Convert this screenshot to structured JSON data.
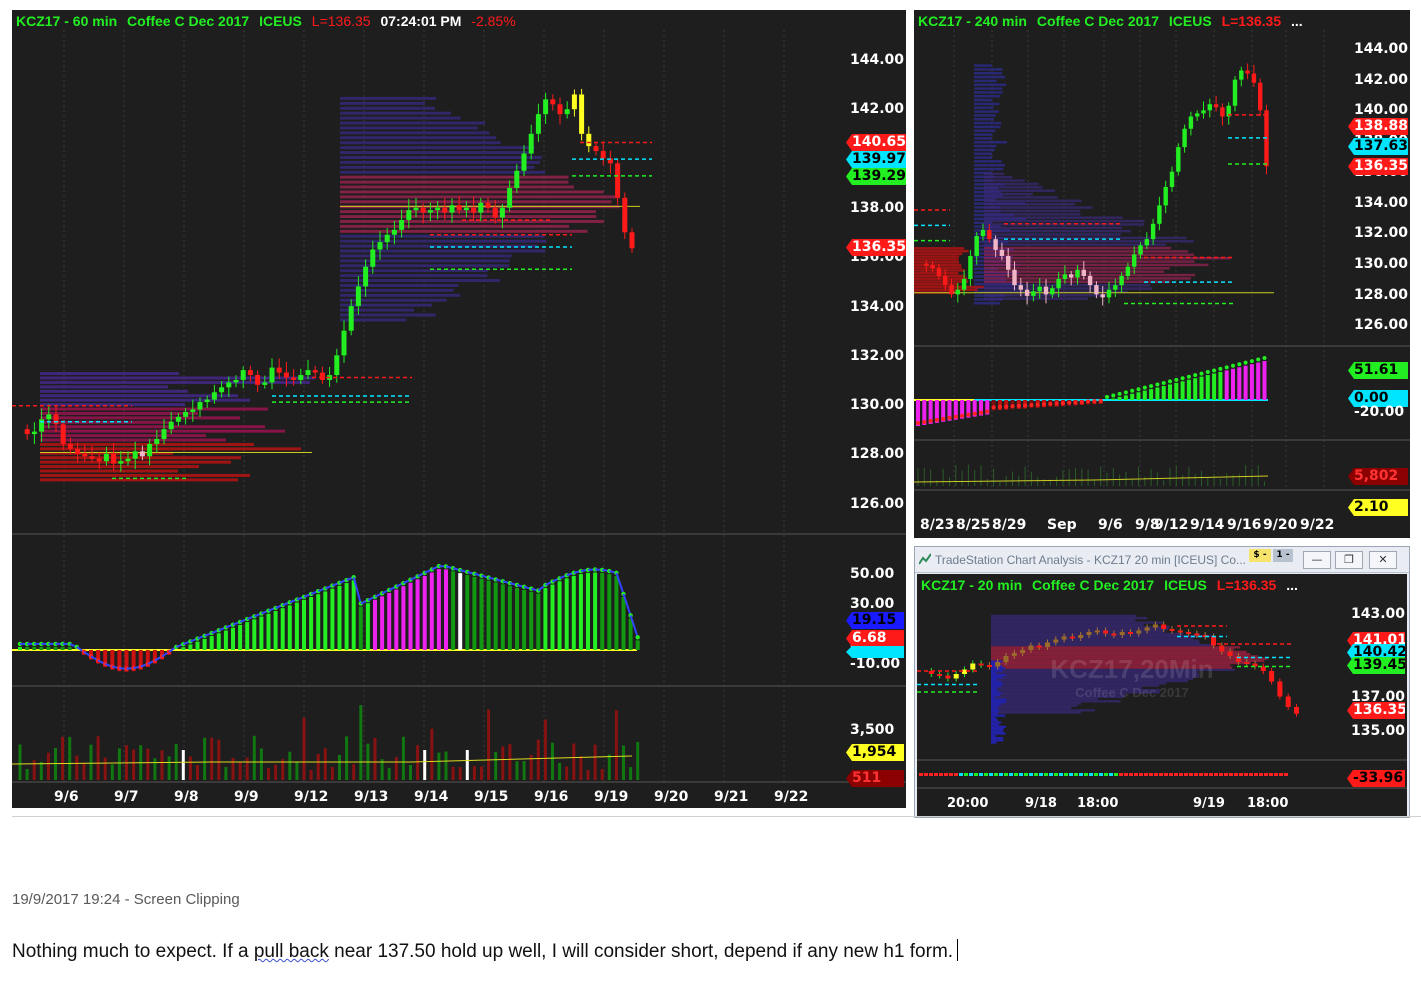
{
  "left_chart": {
    "symbol": "KCZ17 - 60 min",
    "name": "Coffee C Dec 2017",
    "exchange": "ICEUS",
    "last": "L=136.35",
    "time": "07:24:01 PM",
    "change": "-2.85%",
    "price_axis": [
      "144.00",
      "142.00",
      "140.00",
      "138.00",
      "136.00",
      "134.00",
      "132.00",
      "130.00",
      "128.00",
      "126.00"
    ],
    "price_flags": [
      {
        "label": "140.65",
        "color": "#ff1a1a",
        "text": "#ffffff"
      },
      {
        "label": "139.97",
        "color": "#00e5ff",
        "text": "#000000"
      },
      {
        "label": "139.29",
        "color": "#22ee22",
        "text": "#000000"
      },
      {
        "label": "136.35",
        "color": "#ff1a1a",
        "text": "#ffffff"
      }
    ],
    "osc_axis": [
      "50.00",
      "30.00",
      "0.00",
      "-10.00"
    ],
    "osc_flags": [
      {
        "label": "19.15",
        "color": "#1a1aff",
        "text": "#000000"
      },
      {
        "label": "6.68",
        "color": "#ff1a1a",
        "text": "#ffffff"
      },
      {
        "label": "",
        "color": "#00e5ff",
        "text": "#000000"
      }
    ],
    "vol_axis": [
      "3,500"
    ],
    "vol_flags": [
      {
        "label": "1,954",
        "color": "#ffff22",
        "text": "#000000"
      },
      {
        "label": "511",
        "color": "#8b0000",
        "text": "#ff3333"
      }
    ],
    "dates": [
      "9/6",
      "9/7",
      "9/8",
      "9/9",
      "9/12",
      "9/13",
      "9/14",
      "9/15",
      "9/16",
      "9/19",
      "9/20",
      "9/21",
      "9/22"
    ]
  },
  "right_top_chart": {
    "symbol": "KCZ17 - 240 min",
    "name": "Coffee C Dec 2017",
    "exchange": "ICEUS",
    "last": "L=136.35",
    "more": "...",
    "price_axis": [
      "144.00",
      "142.00",
      "140.00",
      "138.00",
      "136.00",
      "134.00",
      "132.00",
      "130.00",
      "128.00",
      "126.00"
    ],
    "price_flags": [
      {
        "label": "138.88",
        "color": "#ff1a1a",
        "text": "#ffffff"
      },
      {
        "label": "137.63",
        "color": "#00e5ff",
        "text": "#000000"
      },
      {
        "label": "136.35",
        "color": "#ff1a1a",
        "text": "#ffffff"
      }
    ],
    "osc_flags": [
      {
        "label": "51.61",
        "color": "#22ee22",
        "text": "#000000"
      },
      {
        "label": "0.00",
        "color": "#00e5ff",
        "text": "#000000"
      }
    ],
    "osc_axis": [
      "-20.00"
    ],
    "vol_flags": [
      {
        "label": "5,802",
        "color": "#8b0000",
        "text": "#ff3333"
      },
      {
        "label": "2.10",
        "color": "#ffff22",
        "text": "#000000"
      }
    ],
    "dates": [
      "8/23",
      "8/25",
      "8/29",
      "Sep",
      "9/6",
      "9/8",
      "9/12",
      "9/14",
      "9/16",
      "9/20",
      "9/22"
    ]
  },
  "popup_window": {
    "window_title": "TradeStation Chart Analysis - KCZ17 20 min [ICEUS] Co...",
    "badge": "$ -",
    "badge2": "1 -",
    "buttons": {
      "minimize": "—",
      "restore": "❐",
      "close": "✕"
    },
    "symbol": "KCZ17 - 20 min",
    "name": "Coffee C Dec 2017",
    "exchange": "ICEUS",
    "last": "L=136.35",
    "more": "...",
    "watermark_main": "KCZ17,20Min",
    "watermark_sub": "Coffee C Dec 2017",
    "price_axis": [
      "143.00",
      "137.00",
      "135.00"
    ],
    "price_flags": [
      {
        "label": "141.01",
        "color": "#ff1a1a",
        "text": "#ffffff"
      },
      {
        "label": "140.42",
        "color": "#00e5ff",
        "text": "#000000"
      },
      {
        "label": "139.45",
        "color": "#22ee22",
        "text": "#000000"
      },
      {
        "label": "136.35",
        "color": "#ff1a1a",
        "text": "#ffffff"
      }
    ],
    "osc_flags": [
      {
        "label": "-33.96",
        "color": "#ff1a1a",
        "text": "#000000"
      }
    ],
    "dates": [
      "20:00",
      "9/18",
      "18:00",
      "9/19",
      "18:00"
    ]
  },
  "caption": {
    "timestamp": "19/9/2017 19:24 - Screen Clipping",
    "note_part1": "Nothing much to expect. If a ",
    "note_misspelled": "pull back",
    "note_part2": " near 137.50 hold up well, I will consider short, depend if any new h1 form."
  },
  "colors": {
    "background": "#1e1e1e",
    "up_candle": "#22ee22",
    "down_candle": "#ff1a1a",
    "title_green": "#22ee22",
    "title_red": "#ff1a1a"
  }
}
